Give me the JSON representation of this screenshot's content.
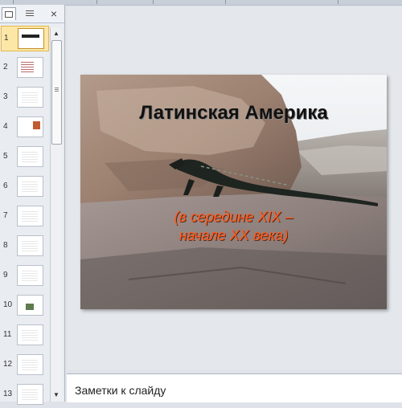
{
  "thumbnails": {
    "tabs": [
      {
        "name": "slides-tab"
      },
      {
        "name": "outline-tab"
      }
    ],
    "close_label": "×",
    "slides": [
      {
        "number": "1",
        "style": "pic1",
        "selected": true
      },
      {
        "number": "2",
        "style": "lightish",
        "selected": false
      },
      {
        "number": "3",
        "style": "dark",
        "selected": false
      },
      {
        "number": "4",
        "style": "pic4",
        "selected": false
      },
      {
        "number": "5",
        "style": "dark",
        "selected": false
      },
      {
        "number": "6",
        "style": "dark",
        "selected": false
      },
      {
        "number": "7",
        "style": "dark",
        "selected": false
      },
      {
        "number": "8",
        "style": "dark",
        "selected": false
      },
      {
        "number": "9",
        "style": "dark",
        "selected": false
      },
      {
        "number": "10",
        "style": "pic10",
        "selected": false
      },
      {
        "number": "11",
        "style": "dark",
        "selected": false
      },
      {
        "number": "12",
        "style": "dark",
        "selected": false
      },
      {
        "number": "13",
        "style": "dark",
        "selected": false
      }
    ]
  },
  "slide": {
    "title": "Латинская Америка",
    "subtitle_line1": "(в середине XIX –",
    "subtitle_line2": "начале XX века)"
  },
  "notes": {
    "placeholder": "Заметки к слайду"
  },
  "colors": {
    "selection": "#fde7a7",
    "subtitle": "#ff5a1f"
  }
}
